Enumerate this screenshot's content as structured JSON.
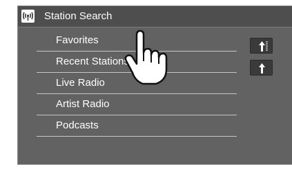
{
  "header": {
    "title": "Station Search",
    "icon": "radio-antenna-icon"
  },
  "list": {
    "items": [
      {
        "label": "Favorites"
      },
      {
        "label": "Recent Stations"
      },
      {
        "label": "Live Radio"
      },
      {
        "label": "Artist Radio"
      },
      {
        "label": "Podcasts"
      }
    ]
  },
  "scroll": {
    "top_icon": "jump-to-top-icon",
    "up_icon": "page-up-icon"
  },
  "overlay": {
    "icon": "tap-hand-icon"
  }
}
